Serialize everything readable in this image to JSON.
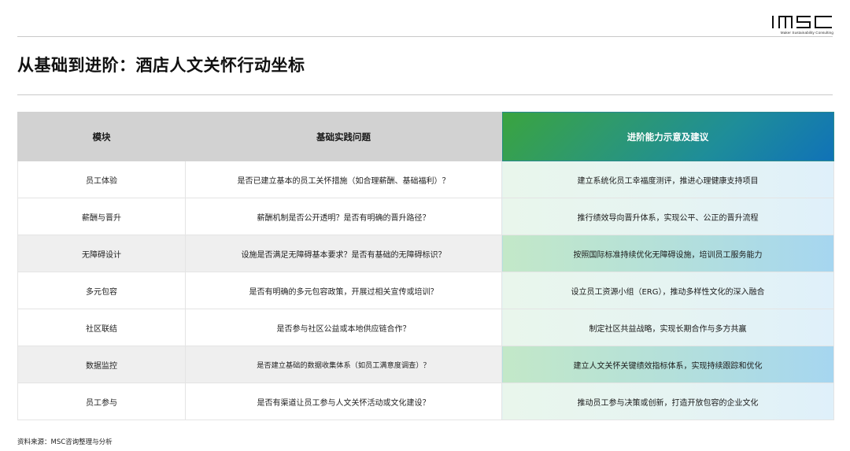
{
  "logo": {
    "mark_text": "MSC",
    "tagline": "Maker Sustainability Consulting"
  },
  "page_title": "从基础到进阶：酒店人文关怀行动坐标",
  "table": {
    "headers": {
      "module": "模块",
      "question": "基础实践问题",
      "advanced": "进阶能力示意及建议"
    },
    "rows": [
      {
        "module": "员工体验",
        "question": "是否已建立基本的员工关怀措施（如合理薪酬、基础福利）？",
        "advanced": "建立系统化员工幸福度测评，推进心理健康支持项目"
      },
      {
        "module": "薪酬与晋升",
        "question": "薪酬机制是否公开透明？是否有明确的晋升路径？",
        "advanced": "推行绩效导向晋升体系，实现公平、公正的晋升流程"
      },
      {
        "module": "无障碍设计",
        "question": "设施是否满足无障碍基本要求？是否有基础的无障碍标识？",
        "advanced": "按照国际标准持续优化无障碍设施，培训员工服务能力"
      },
      {
        "module": "多元包容",
        "question": "是否有明确的多元包容政策，开展过相关宣传或培训？",
        "advanced": "设立员工资源小组（ERG），推动多样性文化的深入融合"
      },
      {
        "module": "社区联结",
        "question": "是否参与社区公益或本地供应链合作？",
        "advanced": "制定社区共益战略，实现长期合作与多方共赢"
      },
      {
        "module": "数据监控",
        "question": "是否建立基础的数据收集体系（如员工满意度调查）？",
        "advanced": "建立人文关怀关键绩效指标体系，实现持续跟踪和优化"
      },
      {
        "module": "员工参与",
        "question": "是否有渠道让员工参与人文关怀活动或文化建设？",
        "advanced": "推动员工参与决策或创新，打造开放包容的企业文化"
      }
    ]
  },
  "source_note": "资料来源：MSC咨询整理与分析",
  "colors": {
    "header_grey": "#d2d2d2",
    "gradient_green": "#3aa43f",
    "gradient_blue": "#1072b8"
  }
}
